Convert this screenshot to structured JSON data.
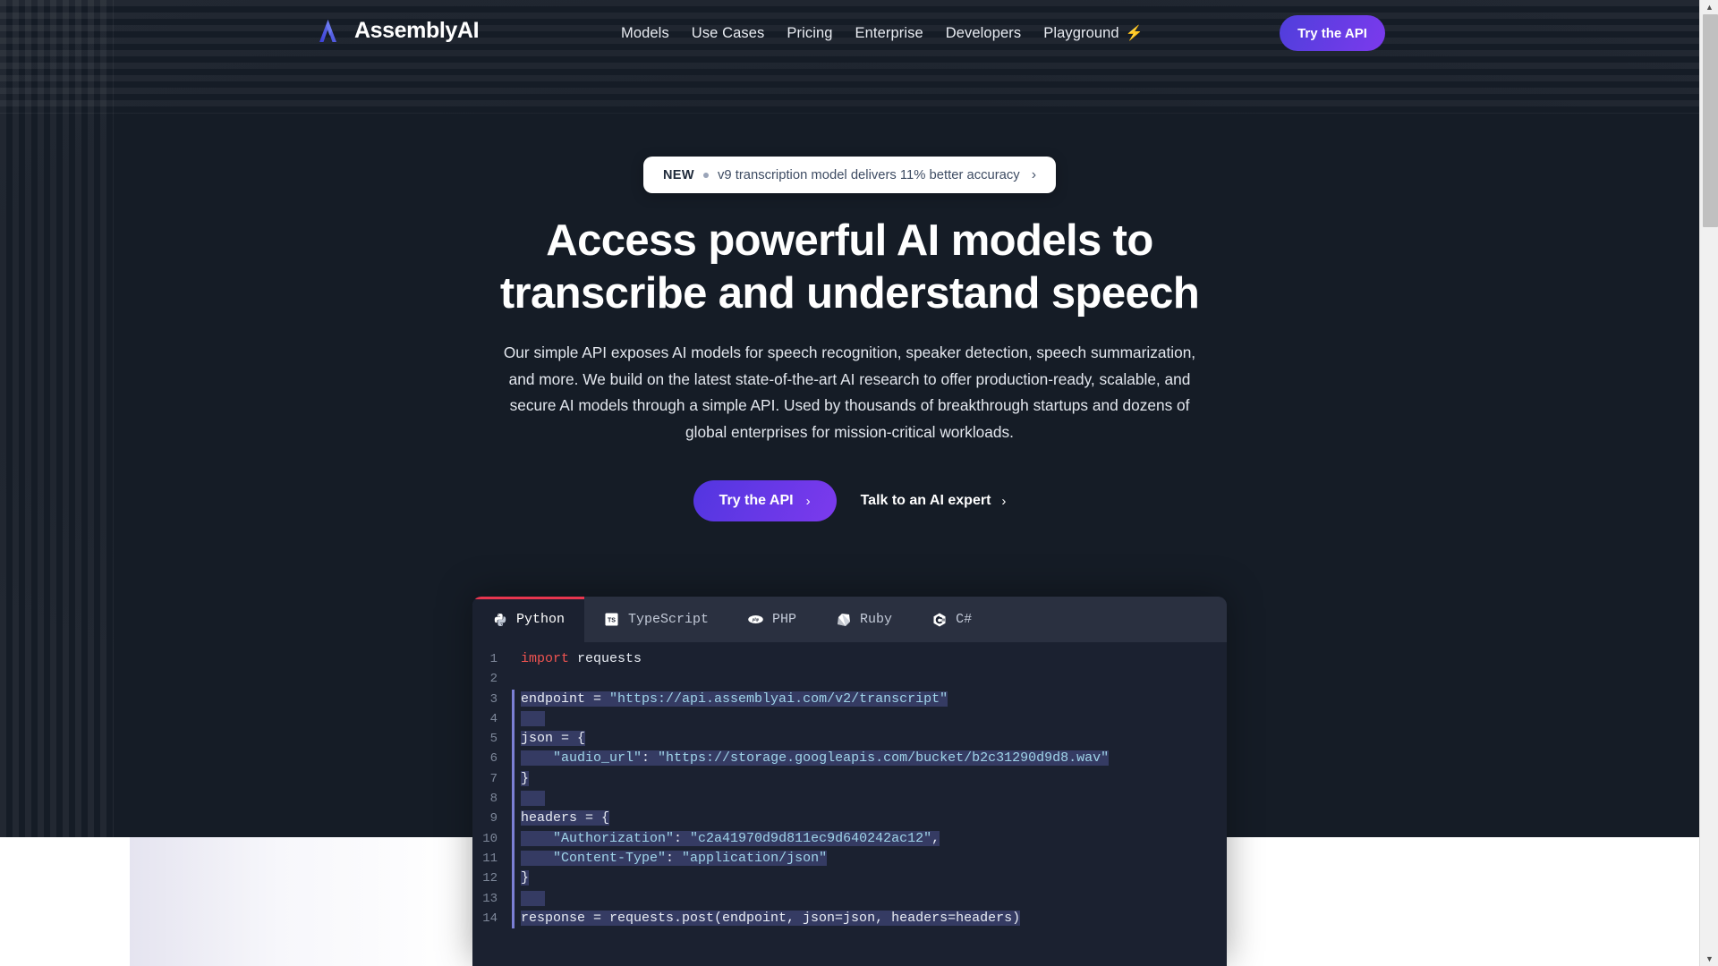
{
  "header": {
    "logo_text": "AssemblyAI",
    "logo_icon": "assemblyai-lambda-logo",
    "nav": [
      {
        "label": "Models",
        "icon": null
      },
      {
        "label": "Use Cases",
        "icon": null
      },
      {
        "label": "Pricing",
        "icon": null
      },
      {
        "label": "Enterprise",
        "icon": null
      },
      {
        "label": "Developers",
        "icon": null
      },
      {
        "label": "Playground",
        "icon": "lightning-bolt-icon"
      }
    ],
    "cta_label": "Try the API"
  },
  "announcement": {
    "badge": "NEW",
    "text": "v9 transcription model delivers 11% better accuracy",
    "chevron": "›"
  },
  "hero": {
    "title": "Access powerful AI models to transcribe and understand speech",
    "subtitle": "Our simple API exposes AI models for speech recognition, speaker detection, speech summarization, and more. We build on the latest state-of-the-art AI research to offer production-ready, scalable, and secure AI models through a simple API. Used by thousands of breakthrough startups and dozens of global enterprises for mission-critical workloads.",
    "primary_cta": "Try the API",
    "secondary_cta": "Talk to an AI expert",
    "chevron": "›"
  },
  "code_panel": {
    "tabs": [
      {
        "label": "Python",
        "icon": "python-logo-icon",
        "active": true
      },
      {
        "label": "TypeScript",
        "icon": "typescript-logo-icon",
        "active": false
      },
      {
        "label": "PHP",
        "icon": "php-logo-icon",
        "active": false
      },
      {
        "label": "Ruby",
        "icon": "ruby-logo-icon",
        "active": false
      },
      {
        "label": "C#",
        "icon": "csharp-logo-icon",
        "active": false
      }
    ],
    "active_language": "Python",
    "lines": [
      {
        "n": "1",
        "selected": false,
        "tokens": [
          {
            "t": "kw",
            "s": "import"
          },
          {
            "t": "plain",
            "s": " requests"
          }
        ]
      },
      {
        "n": "2",
        "selected": false,
        "tokens": []
      },
      {
        "n": "3",
        "selected": true,
        "tokens": [
          {
            "t": "plain",
            "s": "endpoint = "
          },
          {
            "t": "str",
            "s": "\"https://api.assemblyai.com/v2/transcript\""
          }
        ]
      },
      {
        "n": "4",
        "selected": true,
        "tokens": []
      },
      {
        "n": "5",
        "selected": true,
        "tokens": [
          {
            "t": "plain",
            "s": "json = {"
          }
        ]
      },
      {
        "n": "6",
        "selected": true,
        "tokens": [
          {
            "t": "str",
            "s": "    \"audio_url\""
          },
          {
            "t": "plain",
            "s": ": "
          },
          {
            "t": "str",
            "s": "\"https://storage.googleapis.com/bucket/b2c31290d9d8.wav\""
          }
        ]
      },
      {
        "n": "7",
        "selected": true,
        "tokens": [
          {
            "t": "plain",
            "s": "}"
          }
        ]
      },
      {
        "n": "8",
        "selected": true,
        "tokens": []
      },
      {
        "n": "9",
        "selected": true,
        "tokens": [
          {
            "t": "plain",
            "s": "headers = {"
          }
        ]
      },
      {
        "n": "10",
        "selected": true,
        "tokens": [
          {
            "t": "str",
            "s": "    \"Authorization\""
          },
          {
            "t": "plain",
            "s": ": "
          },
          {
            "t": "str",
            "s": "\"c2a41970d9d811ec9d640242ac12\""
          },
          {
            "t": "plain",
            "s": ","
          }
        ]
      },
      {
        "n": "11",
        "selected": true,
        "tokens": [
          {
            "t": "str",
            "s": "    \"Content-Type\""
          },
          {
            "t": "plain",
            "s": ": "
          },
          {
            "t": "str",
            "s": "\"application/json\""
          }
        ]
      },
      {
        "n": "12",
        "selected": true,
        "tokens": [
          {
            "t": "plain",
            "s": "}"
          }
        ]
      },
      {
        "n": "13",
        "selected": true,
        "tokens": []
      },
      {
        "n": "14",
        "selected": true,
        "tokens": [
          {
            "t": "plain",
            "s": "response = requests.post(endpoint, json=json, headers=headers)"
          }
        ]
      }
    ]
  },
  "colors": {
    "hero_background": "#151c26",
    "accent_purple": "#6d3fe8",
    "accent_orange": "#f97316",
    "tab_active_underline": "#e8364f",
    "code_panel_bg": "#1b2130",
    "code_tabbar_bg": "#2a3040",
    "selection_highlight": "#353b63",
    "selection_bar": "#7b7fd4"
  },
  "scrollbar": {
    "up_arrow": "▲",
    "down_arrow": "▼"
  }
}
